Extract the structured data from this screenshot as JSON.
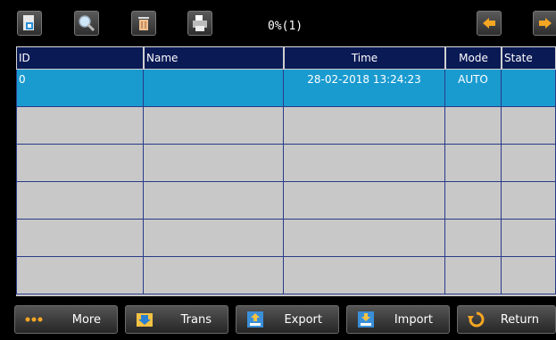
{
  "toolbar": {
    "progress": "0%(1)",
    "icons": [
      "document-icon",
      "search-icon",
      "trash-icon",
      "printer-icon",
      "arrow-left-icon",
      "arrow-right-icon"
    ]
  },
  "table": {
    "headers": [
      "ID",
      "Name",
      "Time",
      "Mode",
      "State"
    ],
    "rows": [
      {
        "id": "0",
        "name": "",
        "time": "28-02-2018 13:24:23",
        "mode": "AUTO",
        "state": ""
      }
    ]
  },
  "bottom": {
    "more": "More",
    "trans": "Trans",
    "export": "Export",
    "import": "Import",
    "return": "Return"
  },
  "colors": {
    "header_bg": "#0a1a55",
    "selected_row": "#1a9bd0",
    "empty_row": "#c8c8c8",
    "accent_orange": "#f5a623"
  }
}
